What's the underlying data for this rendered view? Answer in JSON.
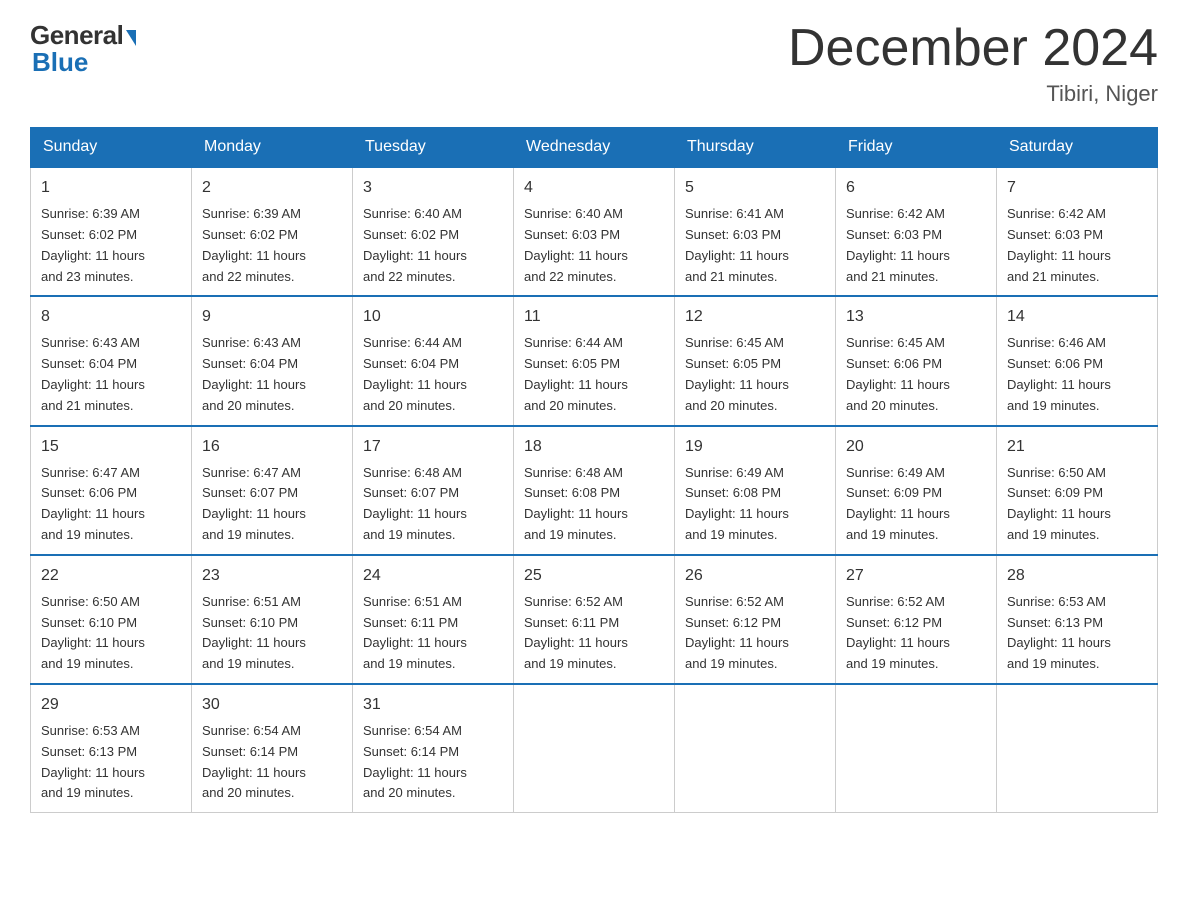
{
  "header": {
    "logo_general": "General",
    "logo_blue": "Blue",
    "month_title": "December 2024",
    "location": "Tibiri, Niger"
  },
  "days_of_week": [
    "Sunday",
    "Monday",
    "Tuesday",
    "Wednesday",
    "Thursday",
    "Friday",
    "Saturday"
  ],
  "weeks": [
    [
      {
        "day": "1",
        "sunrise": "6:39 AM",
        "sunset": "6:02 PM",
        "daylight": "11 hours and 23 minutes."
      },
      {
        "day": "2",
        "sunrise": "6:39 AM",
        "sunset": "6:02 PM",
        "daylight": "11 hours and 22 minutes."
      },
      {
        "day": "3",
        "sunrise": "6:40 AM",
        "sunset": "6:02 PM",
        "daylight": "11 hours and 22 minutes."
      },
      {
        "day": "4",
        "sunrise": "6:40 AM",
        "sunset": "6:03 PM",
        "daylight": "11 hours and 22 minutes."
      },
      {
        "day": "5",
        "sunrise": "6:41 AM",
        "sunset": "6:03 PM",
        "daylight": "11 hours and 21 minutes."
      },
      {
        "day": "6",
        "sunrise": "6:42 AM",
        "sunset": "6:03 PM",
        "daylight": "11 hours and 21 minutes."
      },
      {
        "day": "7",
        "sunrise": "6:42 AM",
        "sunset": "6:03 PM",
        "daylight": "11 hours and 21 minutes."
      }
    ],
    [
      {
        "day": "8",
        "sunrise": "6:43 AM",
        "sunset": "6:04 PM",
        "daylight": "11 hours and 21 minutes."
      },
      {
        "day": "9",
        "sunrise": "6:43 AM",
        "sunset": "6:04 PM",
        "daylight": "11 hours and 20 minutes."
      },
      {
        "day": "10",
        "sunrise": "6:44 AM",
        "sunset": "6:04 PM",
        "daylight": "11 hours and 20 minutes."
      },
      {
        "day": "11",
        "sunrise": "6:44 AM",
        "sunset": "6:05 PM",
        "daylight": "11 hours and 20 minutes."
      },
      {
        "day": "12",
        "sunrise": "6:45 AM",
        "sunset": "6:05 PM",
        "daylight": "11 hours and 20 minutes."
      },
      {
        "day": "13",
        "sunrise": "6:45 AM",
        "sunset": "6:06 PM",
        "daylight": "11 hours and 20 minutes."
      },
      {
        "day": "14",
        "sunrise": "6:46 AM",
        "sunset": "6:06 PM",
        "daylight": "11 hours and 19 minutes."
      }
    ],
    [
      {
        "day": "15",
        "sunrise": "6:47 AM",
        "sunset": "6:06 PM",
        "daylight": "11 hours and 19 minutes."
      },
      {
        "day": "16",
        "sunrise": "6:47 AM",
        "sunset": "6:07 PM",
        "daylight": "11 hours and 19 minutes."
      },
      {
        "day": "17",
        "sunrise": "6:48 AM",
        "sunset": "6:07 PM",
        "daylight": "11 hours and 19 minutes."
      },
      {
        "day": "18",
        "sunrise": "6:48 AM",
        "sunset": "6:08 PM",
        "daylight": "11 hours and 19 minutes."
      },
      {
        "day": "19",
        "sunrise": "6:49 AM",
        "sunset": "6:08 PM",
        "daylight": "11 hours and 19 minutes."
      },
      {
        "day": "20",
        "sunrise": "6:49 AM",
        "sunset": "6:09 PM",
        "daylight": "11 hours and 19 minutes."
      },
      {
        "day": "21",
        "sunrise": "6:50 AM",
        "sunset": "6:09 PM",
        "daylight": "11 hours and 19 minutes."
      }
    ],
    [
      {
        "day": "22",
        "sunrise": "6:50 AM",
        "sunset": "6:10 PM",
        "daylight": "11 hours and 19 minutes."
      },
      {
        "day": "23",
        "sunrise": "6:51 AM",
        "sunset": "6:10 PM",
        "daylight": "11 hours and 19 minutes."
      },
      {
        "day": "24",
        "sunrise": "6:51 AM",
        "sunset": "6:11 PM",
        "daylight": "11 hours and 19 minutes."
      },
      {
        "day": "25",
        "sunrise": "6:52 AM",
        "sunset": "6:11 PM",
        "daylight": "11 hours and 19 minutes."
      },
      {
        "day": "26",
        "sunrise": "6:52 AM",
        "sunset": "6:12 PM",
        "daylight": "11 hours and 19 minutes."
      },
      {
        "day": "27",
        "sunrise": "6:52 AM",
        "sunset": "6:12 PM",
        "daylight": "11 hours and 19 minutes."
      },
      {
        "day": "28",
        "sunrise": "6:53 AM",
        "sunset": "6:13 PM",
        "daylight": "11 hours and 19 minutes."
      }
    ],
    [
      {
        "day": "29",
        "sunrise": "6:53 AM",
        "sunset": "6:13 PM",
        "daylight": "11 hours and 19 minutes."
      },
      {
        "day": "30",
        "sunrise": "6:54 AM",
        "sunset": "6:14 PM",
        "daylight": "11 hours and 20 minutes."
      },
      {
        "day": "31",
        "sunrise": "6:54 AM",
        "sunset": "6:14 PM",
        "daylight": "11 hours and 20 minutes."
      },
      null,
      null,
      null,
      null
    ]
  ],
  "labels": {
    "sunrise": "Sunrise:",
    "sunset": "Sunset:",
    "daylight": "Daylight:"
  }
}
